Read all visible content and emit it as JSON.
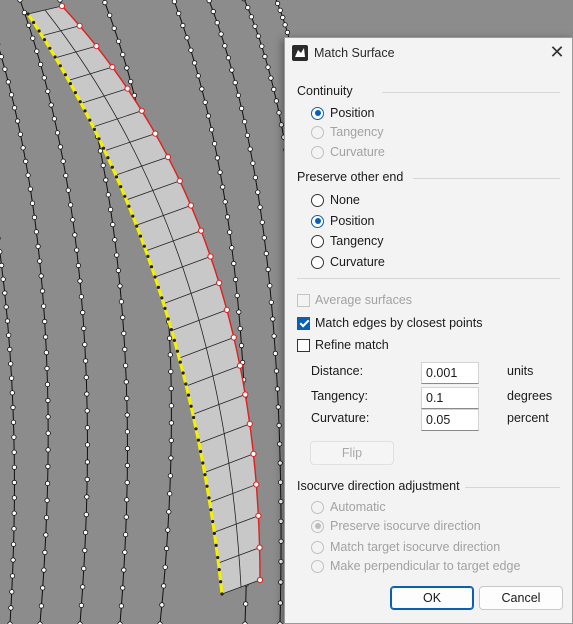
{
  "dialog": {
    "title": "Match Surface",
    "close_glyph": "✕",
    "continuity": {
      "heading": "Continuity",
      "options": [
        {
          "label": "Position",
          "selected": true,
          "enabled": true
        },
        {
          "label": "Tangency",
          "selected": false,
          "enabled": false
        },
        {
          "label": "Curvature",
          "selected": false,
          "enabled": false
        }
      ]
    },
    "preserve": {
      "heading": "Preserve other end",
      "options": [
        {
          "label": "None",
          "selected": false,
          "enabled": true
        },
        {
          "label": "Position",
          "selected": true,
          "enabled": true
        },
        {
          "label": "Tangency",
          "selected": false,
          "enabled": true
        },
        {
          "label": "Curvature",
          "selected": false,
          "enabled": true
        }
      ]
    },
    "checks": {
      "average": {
        "label": "Average surfaces",
        "checked": false,
        "enabled": false
      },
      "match_edges": {
        "label": "Match edges by closest points",
        "checked": true,
        "enabled": true
      },
      "refine": {
        "label": "Refine match",
        "checked": false,
        "enabled": true
      }
    },
    "fields": {
      "distance": {
        "label": "Distance:",
        "value": "0.001",
        "unit": "units"
      },
      "tangency": {
        "label": "Tangency:",
        "value": "0.1",
        "unit": "degrees"
      },
      "curvature": {
        "label": "Curvature:",
        "value": "0.05",
        "unit": "percent"
      }
    },
    "flip_label": "Flip",
    "isocurve": {
      "heading": "Isocurve direction adjustment",
      "options": [
        {
          "label": "Automatic",
          "selected": false,
          "enabled": false
        },
        {
          "label": "Preserve isocurve direction",
          "selected": true,
          "enabled": false
        },
        {
          "label": "Match target isocurve direction",
          "selected": false,
          "enabled": false
        },
        {
          "label": "Make perpendicular to target edge",
          "selected": false,
          "enabled": false
        }
      ]
    },
    "ok_label": "OK",
    "cancel_label": "Cancel"
  },
  "viewport": {
    "background": "#8c8c8c",
    "surface_fill": "#c8c8c8",
    "selected_edge_color": "#f5f000",
    "target_edge_color": "#e02020"
  }
}
